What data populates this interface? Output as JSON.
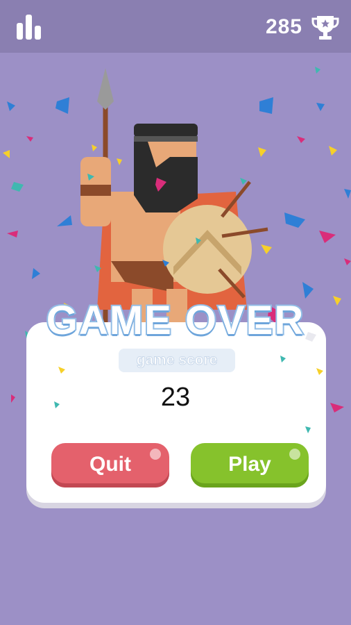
{
  "header": {
    "stats_icon": "bar-chart-icon",
    "best_score": "285",
    "trophy_icon": "trophy-icon"
  },
  "game_over": {
    "title": "GAME OVER",
    "score_label": "game score",
    "score_value": "23"
  },
  "buttons": {
    "quit_label": "Quit",
    "play_label": "Play"
  },
  "colors": {
    "background": "#9c90c6",
    "topbar": "#8a7fb1",
    "quit": "#e4616c",
    "play": "#86c22c",
    "title_outline": "#92bde6"
  }
}
